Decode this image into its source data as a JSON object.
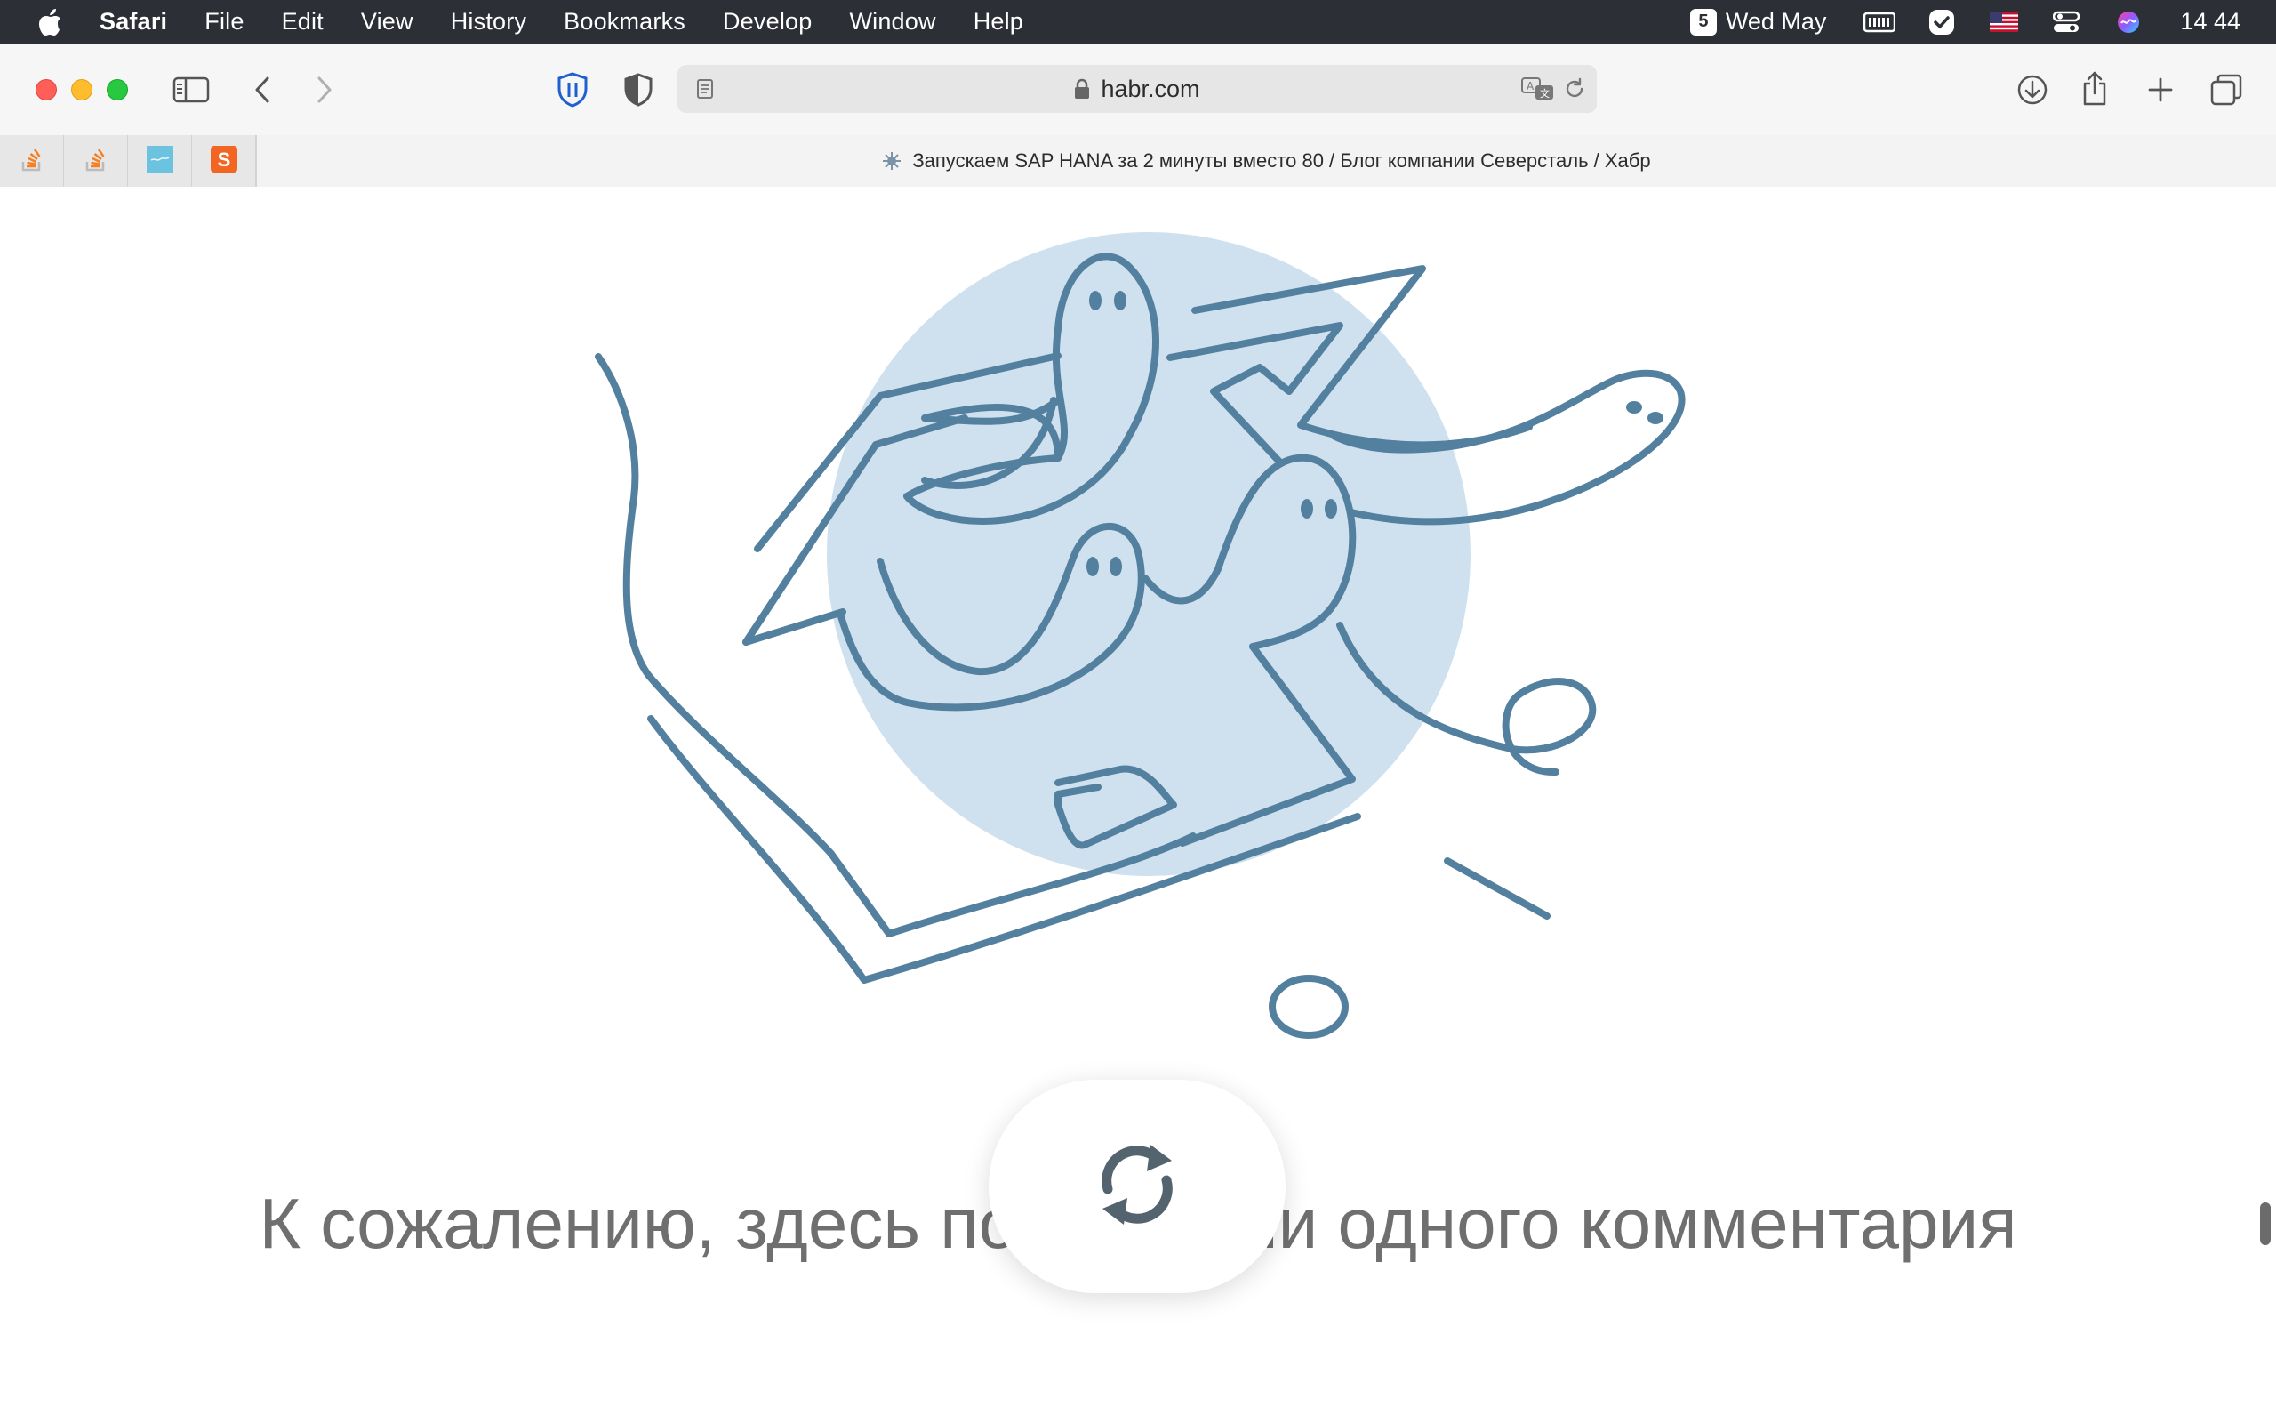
{
  "menubar": {
    "app_name": "Safari",
    "items": [
      "File",
      "Edit",
      "View",
      "History",
      "Bookmarks",
      "Develop",
      "Window",
      "Help"
    ],
    "date_badge": "5",
    "date_text": "Wed May",
    "clock": "14 44",
    "icons": [
      "apple-icon",
      "keyboard-icon",
      "checkmark-app-icon",
      "us-flag-icon",
      "control-center-icon",
      "siri-icon"
    ]
  },
  "toolbar": {
    "url": "habr.com",
    "icons": [
      "sidebar-toggle-icon",
      "back-chevron-icon",
      "forward-chevron-icon",
      "bitwarden-shield-icon",
      "privacy-shield-icon",
      "reader-page-icon",
      "lock-icon",
      "translate-icon",
      "reload-icon",
      "download-icon",
      "share-icon",
      "new-tab-plus-icon",
      "tab-overview-icon"
    ]
  },
  "tabs": {
    "pinned": [
      {
        "name": "stackoverflow-favicon",
        "color": "#f48024"
      },
      {
        "name": "stackoverflow-favicon",
        "color": "#f48024"
      },
      {
        "name": "blue-app-favicon",
        "color": "#6cc3e0"
      },
      {
        "name": "s-logo-favicon",
        "color": "#f26522",
        "letter": "S"
      }
    ],
    "active_title": "Запускаем SAP HANA за 2 минуты вместо 80 / Блог компании Северсталь / Хабр"
  },
  "page": {
    "empty_message": "К сожалению, здесь пока нет ни одного комментария",
    "refresh_icon": "refresh-arrows-icon",
    "colors": {
      "illustration_stroke": "#54809f",
      "illustration_fill": "#cfe1ef",
      "text": "#6f6f6f"
    }
  }
}
